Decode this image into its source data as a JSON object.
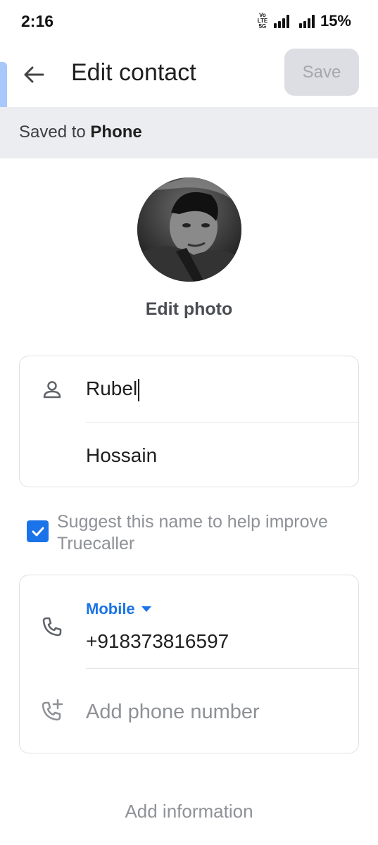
{
  "status_bar": {
    "time": "2:16",
    "volte_label": "Vo LTE 5G",
    "battery": "15%"
  },
  "header": {
    "back_icon": "arrow-left-icon",
    "title": "Edit contact",
    "save_label": "Save"
  },
  "account": {
    "prefix": "Saved to",
    "location": "Phone"
  },
  "photo": {
    "edit_label": "Edit photo"
  },
  "name": {
    "icon": "person-icon",
    "first": "Rubel",
    "last": "Hossain"
  },
  "suggest": {
    "checked": true,
    "label": "Suggest this name to help improve Truecaller"
  },
  "phone": {
    "icon": "phone-icon",
    "type": "Mobile",
    "number": "+918373816597",
    "add_icon": "add-phone-icon",
    "add_placeholder": "Add phone number"
  },
  "footer": {
    "add_information": "Add information"
  },
  "colors": {
    "accent": "#1a73e8",
    "save_disabled_bg": "#dcdee3",
    "banner_bg": "#ecedf0"
  }
}
